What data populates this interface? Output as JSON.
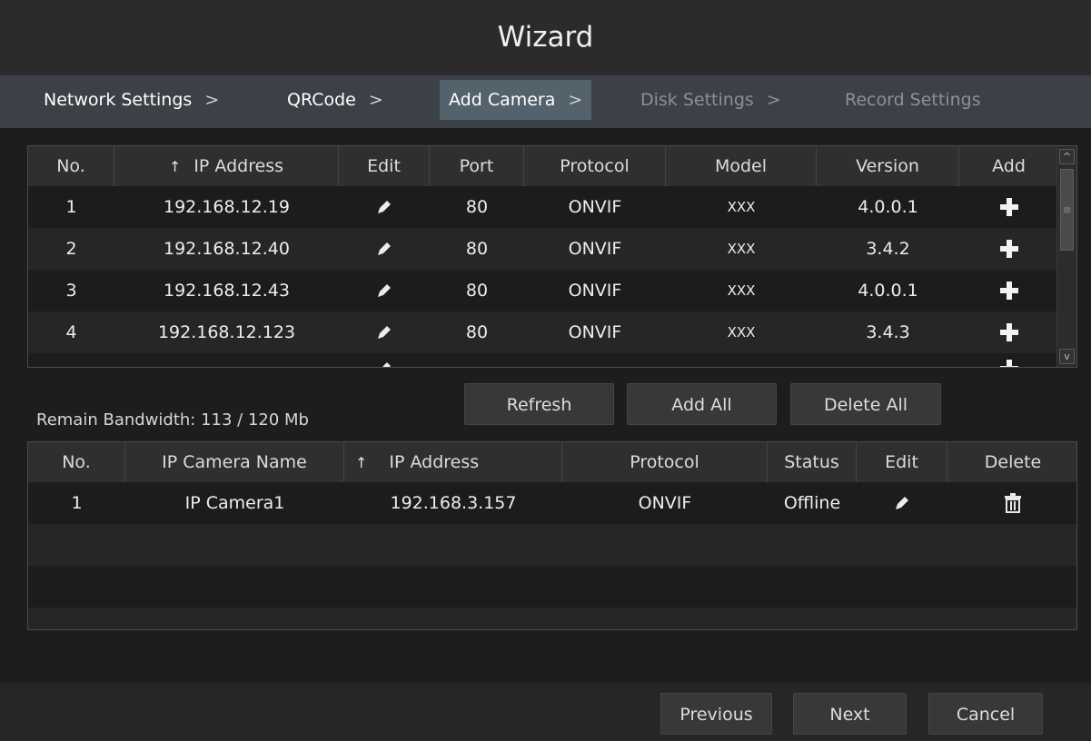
{
  "window": {
    "title": "Wizard"
  },
  "steps": [
    {
      "label": "Network Settings",
      "sep": ">",
      "state": "done"
    },
    {
      "label": "QRCode",
      "sep": ">",
      "state": "done"
    },
    {
      "label": "Add Camera",
      "sep": ">",
      "state": "active"
    },
    {
      "label": "Disk Settings",
      "sep": ">",
      "state": "disabled"
    },
    {
      "label": "Record Settings",
      "sep": "",
      "state": "disabled"
    }
  ],
  "search_table": {
    "headers": [
      "No.",
      "IP Address",
      "Edit",
      "Port",
      "Protocol",
      "Model",
      "Version",
      "Add"
    ],
    "sort_column": "IP Address",
    "sort_arrow": "↑",
    "rows": [
      {
        "no": "1",
        "ip": "192.168.12.19",
        "port": "80",
        "protocol": "ONVIF",
        "model": "XXX",
        "version": "4.0.0.1"
      },
      {
        "no": "2",
        "ip": "192.168.12.40",
        "port": "80",
        "protocol": "ONVIF",
        "model": "XXX",
        "version": "3.4.2"
      },
      {
        "no": "3",
        "ip": "192.168.12.43",
        "port": "80",
        "protocol": "ONVIF",
        "model": "XXX",
        "version": "4.0.0.1"
      },
      {
        "no": "4",
        "ip": "192.168.12.123",
        "port": "80",
        "protocol": "ONVIF",
        "model": "XXX",
        "version": "3.4.3"
      }
    ],
    "scroll_up": "^",
    "scroll_thumb_grip": "≡",
    "scroll_down": "v"
  },
  "actions": {
    "refresh": "Refresh",
    "add_all": "Add All",
    "delete_all": "Delete All"
  },
  "bandwidth": {
    "text": "Remain Bandwidth: 113 / 120 Mb"
  },
  "added_table": {
    "headers": [
      "No.",
      "IP Camera Name",
      "IP Address",
      "Protocol",
      "Status",
      "Edit",
      "Delete"
    ],
    "sort_column": "IP Address",
    "sort_arrow": "↑",
    "rows": [
      {
        "no": "1",
        "name": "IP Camera1",
        "ip": "192.168.3.157",
        "protocol": "ONVIF",
        "status": "Offline"
      }
    ]
  },
  "footer": {
    "previous": "Previous",
    "next": "Next",
    "cancel": "Cancel"
  },
  "colors": {
    "active_step": "#54626b",
    "step_bar": "#3b4146",
    "button": "#383838"
  }
}
